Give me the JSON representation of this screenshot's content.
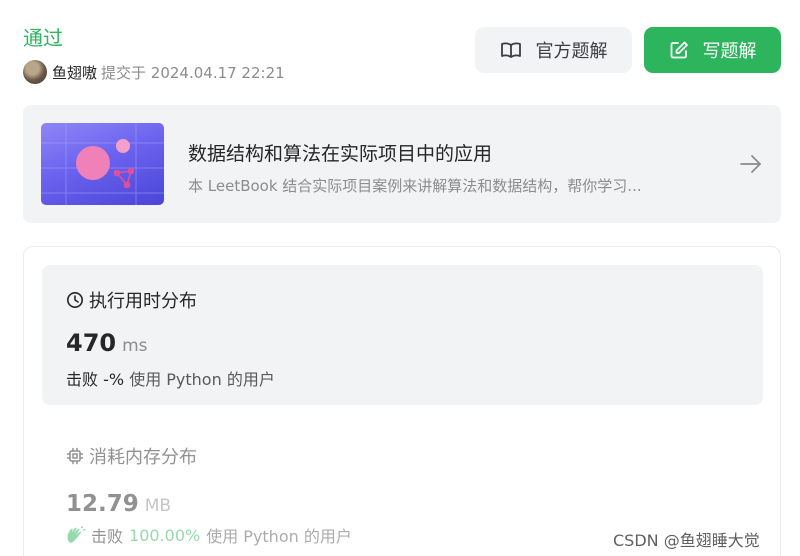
{
  "result": {
    "status": "通过",
    "username": "鱼翅嗷",
    "submitted": "提交于 2024.04.17 22:21"
  },
  "buttons": {
    "official": "官方题解",
    "write": "写题解"
  },
  "leetbook": {
    "title": "数据结构和算法在实际项目中的应用",
    "description": "本 LeetBook 结合实际项目案例来讲解算法和数据结构，帮你学习..."
  },
  "runtime": {
    "title": "执行用时分布",
    "value": "470",
    "unit": "ms",
    "beat_prefix": "击败",
    "beat_pct": "-%",
    "beat_suffix": "使用 Python 的用户"
  },
  "memory": {
    "title": "消耗内存分布",
    "value": "12.79",
    "unit": "MB",
    "beat_prefix": "击败",
    "beat_pct": "100.00%",
    "beat_suffix": "使用 Python 的用户"
  },
  "watermark": "CSDN @鱼翅睡大觉",
  "colors": {
    "accent": "#2db55d",
    "card_bg": "#f2f3f5",
    "muted": "#8c8c8c"
  }
}
